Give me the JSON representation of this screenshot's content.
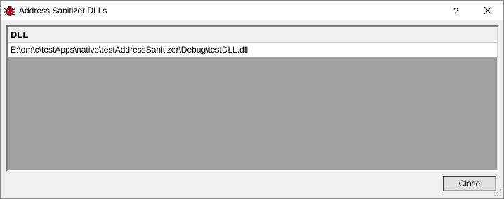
{
  "window": {
    "title": "Address Sanitizer DLLs",
    "help_glyph": "?",
    "close_glyph": "✕",
    "icon": "bug-icon"
  },
  "list": {
    "columns": [
      "DLL"
    ],
    "rows": [
      [
        "E:\\om\\c\\testApps\\native\\testAddressSanitizer\\Debug\\testDLL.dll"
      ]
    ]
  },
  "footer": {
    "close_label": "Close"
  },
  "colors": {
    "list_background": "#a0a0a0",
    "row_background": "#ffffff",
    "icon_red": "#c8102e"
  }
}
